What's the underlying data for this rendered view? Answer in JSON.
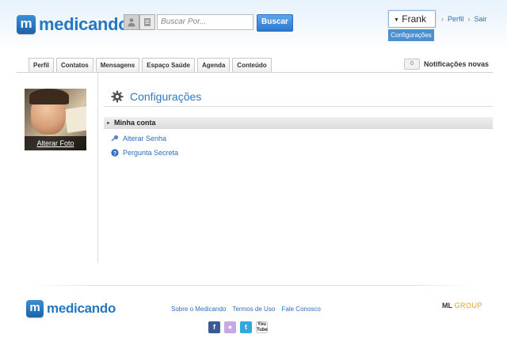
{
  "brand": {
    "logo_letter": "m",
    "name": "medicando"
  },
  "search": {
    "placeholder": "Buscar Por...",
    "button_label": "Buscar"
  },
  "user_menu": {
    "name": "Frank",
    "dropdown_item": "Configurações"
  },
  "top_links": [
    "Perfil",
    "Sair"
  ],
  "tabs": [
    "Perfil",
    "Contatos",
    "Mensagens",
    "Espaço Saúde",
    "Agenda",
    "Conteúdo"
  ],
  "notifications": {
    "count": "0",
    "label": "Notificações novas"
  },
  "profile": {
    "photo_caption": "Alterar Foto"
  },
  "main": {
    "title": "Configurações",
    "section": "Minha conta",
    "links": [
      "Alterar Senha",
      "Pergunta Secreta"
    ]
  },
  "footer": {
    "brand_letter": "m",
    "brand_name": "medicando",
    "links": [
      "Sobre o Medicando",
      "Termos de Uso",
      "Fale Conosco"
    ],
    "social": [
      "facebook-icon",
      "flickr-icon",
      "twitter-icon",
      "youtube-icon"
    ],
    "partner": {
      "prefix": "ML",
      "suffix": "GROUP"
    }
  },
  "colors": {
    "accent": "#2477c2",
    "link": "#2a6fbe",
    "button": "#3a87da"
  }
}
